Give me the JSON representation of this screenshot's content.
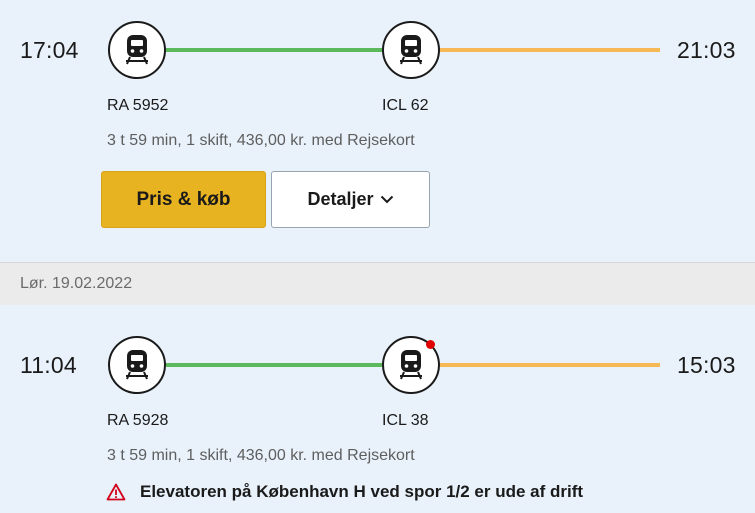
{
  "journeys": [
    {
      "departure": "17:04",
      "arrival": "21:03",
      "legs": [
        {
          "train": "RA 5952",
          "color": "#5cb85c",
          "icon": "train-icon",
          "disruption": false
        },
        {
          "train": "ICL 62",
          "color": "#f7b955",
          "icon": "train-icon",
          "disruption": false
        }
      ],
      "summary": "3 t 59 min, 1 skift, 436,00 kr. med Rejsekort",
      "buy_label": "Pris & køb",
      "details_label": "Detaljer"
    },
    {
      "date": "Lør. 19.02.2022",
      "departure": "11:04",
      "arrival": "15:03",
      "legs": [
        {
          "train": "RA 5928",
          "color": "#5cb85c",
          "icon": "train-icon",
          "disruption": false
        },
        {
          "train": "ICL 38",
          "color": "#f7b955",
          "icon": "train-icon",
          "disruption": true
        }
      ],
      "summary": "3 t 59 min, 1 skift, 436,00 kr. med Rejsekort",
      "alert": "Elevatoren på København H ved spor 1/2 er ude af drift"
    }
  ],
  "colors": {
    "background": "#e9f2fb",
    "buy_button": "#e8b320",
    "disruption_dot": "#e00000",
    "alert_icon": "#d0021b"
  }
}
